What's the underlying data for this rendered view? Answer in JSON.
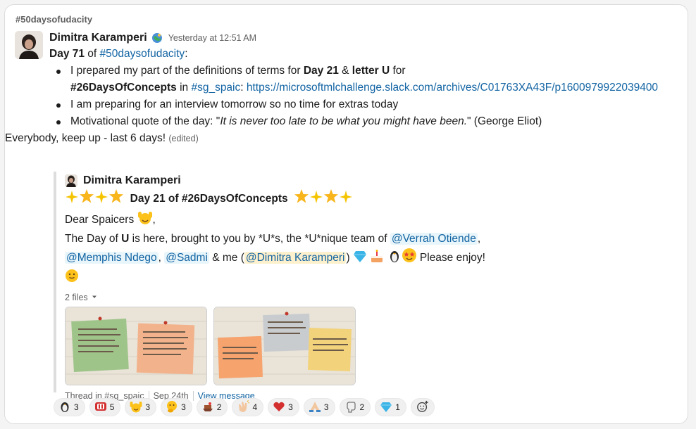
{
  "channel": "#50daysofudacity",
  "message": {
    "author": "Dimitra Karamperi",
    "timestamp": "Yesterday at 12:51 AM",
    "day_label": "Day 71",
    "of": "of",
    "hashtag": "#50daysofudacity",
    "colon": ":",
    "bullets": {
      "b1_prefix": "I prepared my part of the definitions of terms for ",
      "b1_day": "Day 21",
      "b1_amp": " & ",
      "b1_letter": "letter U",
      "b1_for": " for",
      "b1_concepts": "#26DaysOfConcepts",
      "b1_in": " in ",
      "b1_channel": "#sg_spaic",
      "b1_colon": ": ",
      "b1_url": "https://microsoftmlchallenge.slack.com/archives/C01763XA43F/p1600979922039400",
      "b2": "I am preparing for an interview tomorrow so no time for extras today",
      "b3_prefix": "Motivational quote of the day: \"",
      "b3_quote": "It is never too late to be what you might have been.",
      "b3_suffix": "\" (George Eliot)"
    },
    "closing": "Everybody, keep up - last 6 days!",
    "edited": "(edited)"
  },
  "shared": {
    "author": "Dimitra Karamperi",
    "title": "Day 21 of #26DaysOfConcepts",
    "greeting": "Dear Spaicers",
    "comma": ",",
    "line1_a": "The Day of ",
    "line1_u": "U",
    "line1_b": " is here, brought to you by *U*s, the *U*nique team of ",
    "mention1": "@Verrah Otiende",
    "comma2": ",",
    "mention2": "@Memphis Ndego",
    "comma3": ",",
    "mention3": "@Sadmi",
    "me_text": " & me (",
    "mention_self": "@Dimitra Karamperi",
    "close_paren": ")",
    "enjoy": "Please enjoy!",
    "files_label": "2 files",
    "thread_in": "Thread in #sg_spaic",
    "thread_date": "Sep 24th",
    "view_message": "View message"
  },
  "reactions": [
    {
      "icon": "penguin-icon",
      "count": "3"
    },
    {
      "icon": "tv-icon",
      "count": "5"
    },
    {
      "icon": "raised-hands-emoji-icon",
      "count": "3"
    },
    {
      "icon": "thinking-face-icon",
      "count": "3"
    },
    {
      "icon": "lab-icon",
      "count": "2"
    },
    {
      "icon": "clap-icon",
      "count": "4"
    },
    {
      "icon": "red-heart-icon",
      "count": "3"
    },
    {
      "icon": "pray-icon",
      "count": "3"
    },
    {
      "icon": "fist-icon",
      "count": "2"
    },
    {
      "icon": "gem-icon",
      "count": "1"
    }
  ],
  "colors": {
    "link": "#1264a3",
    "mention_bg": "#e8f5fa",
    "self_mention_bg": "#fdf0cc"
  }
}
